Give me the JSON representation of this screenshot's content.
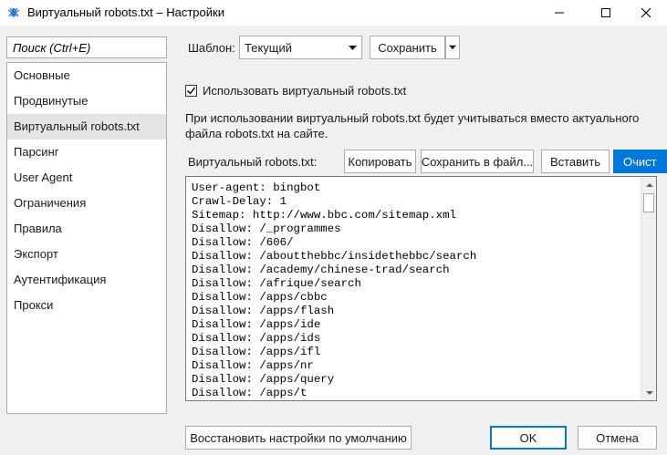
{
  "window": {
    "title": "Виртуальный robots.txt – Настройки",
    "icon": "spider-icon",
    "controls": [
      "minimize-icon",
      "maximize-icon",
      "close-icon"
    ]
  },
  "sidebar": {
    "search_placeholder": "Поиск (Ctrl+E)",
    "selected_index": 2,
    "items": [
      {
        "label": "Основные"
      },
      {
        "label": "Продвинутые"
      },
      {
        "label": "Виртуальный robots.txt"
      },
      {
        "label": "Парсинг"
      },
      {
        "label": "User Agent"
      },
      {
        "label": "Ограничения"
      },
      {
        "label": "Правила"
      },
      {
        "label": "Экспорт"
      },
      {
        "label": "Аутентификация"
      },
      {
        "label": "Прокси"
      }
    ]
  },
  "template": {
    "label": "Шаблон:",
    "selected": "Текущий",
    "save_label": "Сохранить"
  },
  "virtual_robots": {
    "checkbox_label": "Использовать виртуальный robots.txt",
    "checked": true,
    "description_line1": "При использовании виртуальный robots.txt будет учитываться вместо актуального",
    "description_line2": "файла robots.txt на сайте.",
    "editor_label": "Виртуальный robots.txt:",
    "buttons": {
      "copy": "Копировать",
      "save_to_file": "Сохранить в файл...",
      "paste": "Вставить",
      "clear": "Очист"
    },
    "content_lines": [
      "User-agent: bingbot",
      "Crawl-Delay: 1",
      "Sitemap: http://www.bbc.com/sitemap.xml",
      "Disallow: /_programmes",
      "Disallow: /606/",
      "Disallow: /aboutthebbc/insidethebbc/search",
      "Disallow: /academy/chinese-trad/search",
      "Disallow: /afrique/search",
      "Disallow: /apps/cbbc",
      "Disallow: /apps/flash",
      "Disallow: /apps/ide",
      "Disallow: /apps/ids",
      "Disallow: /apps/ifl",
      "Disallow: /apps/nr",
      "Disallow: /apps/query",
      "Disallow: /apps/t"
    ]
  },
  "footer": {
    "restore_label": "Восстановить настройки по умолчанию",
    "ok_label": "OK",
    "cancel_label": "Отмена"
  },
  "colors": {
    "accent": "#0078d7",
    "window_bg": "#f0f0f0",
    "selected_item": "#e5e5e5"
  }
}
